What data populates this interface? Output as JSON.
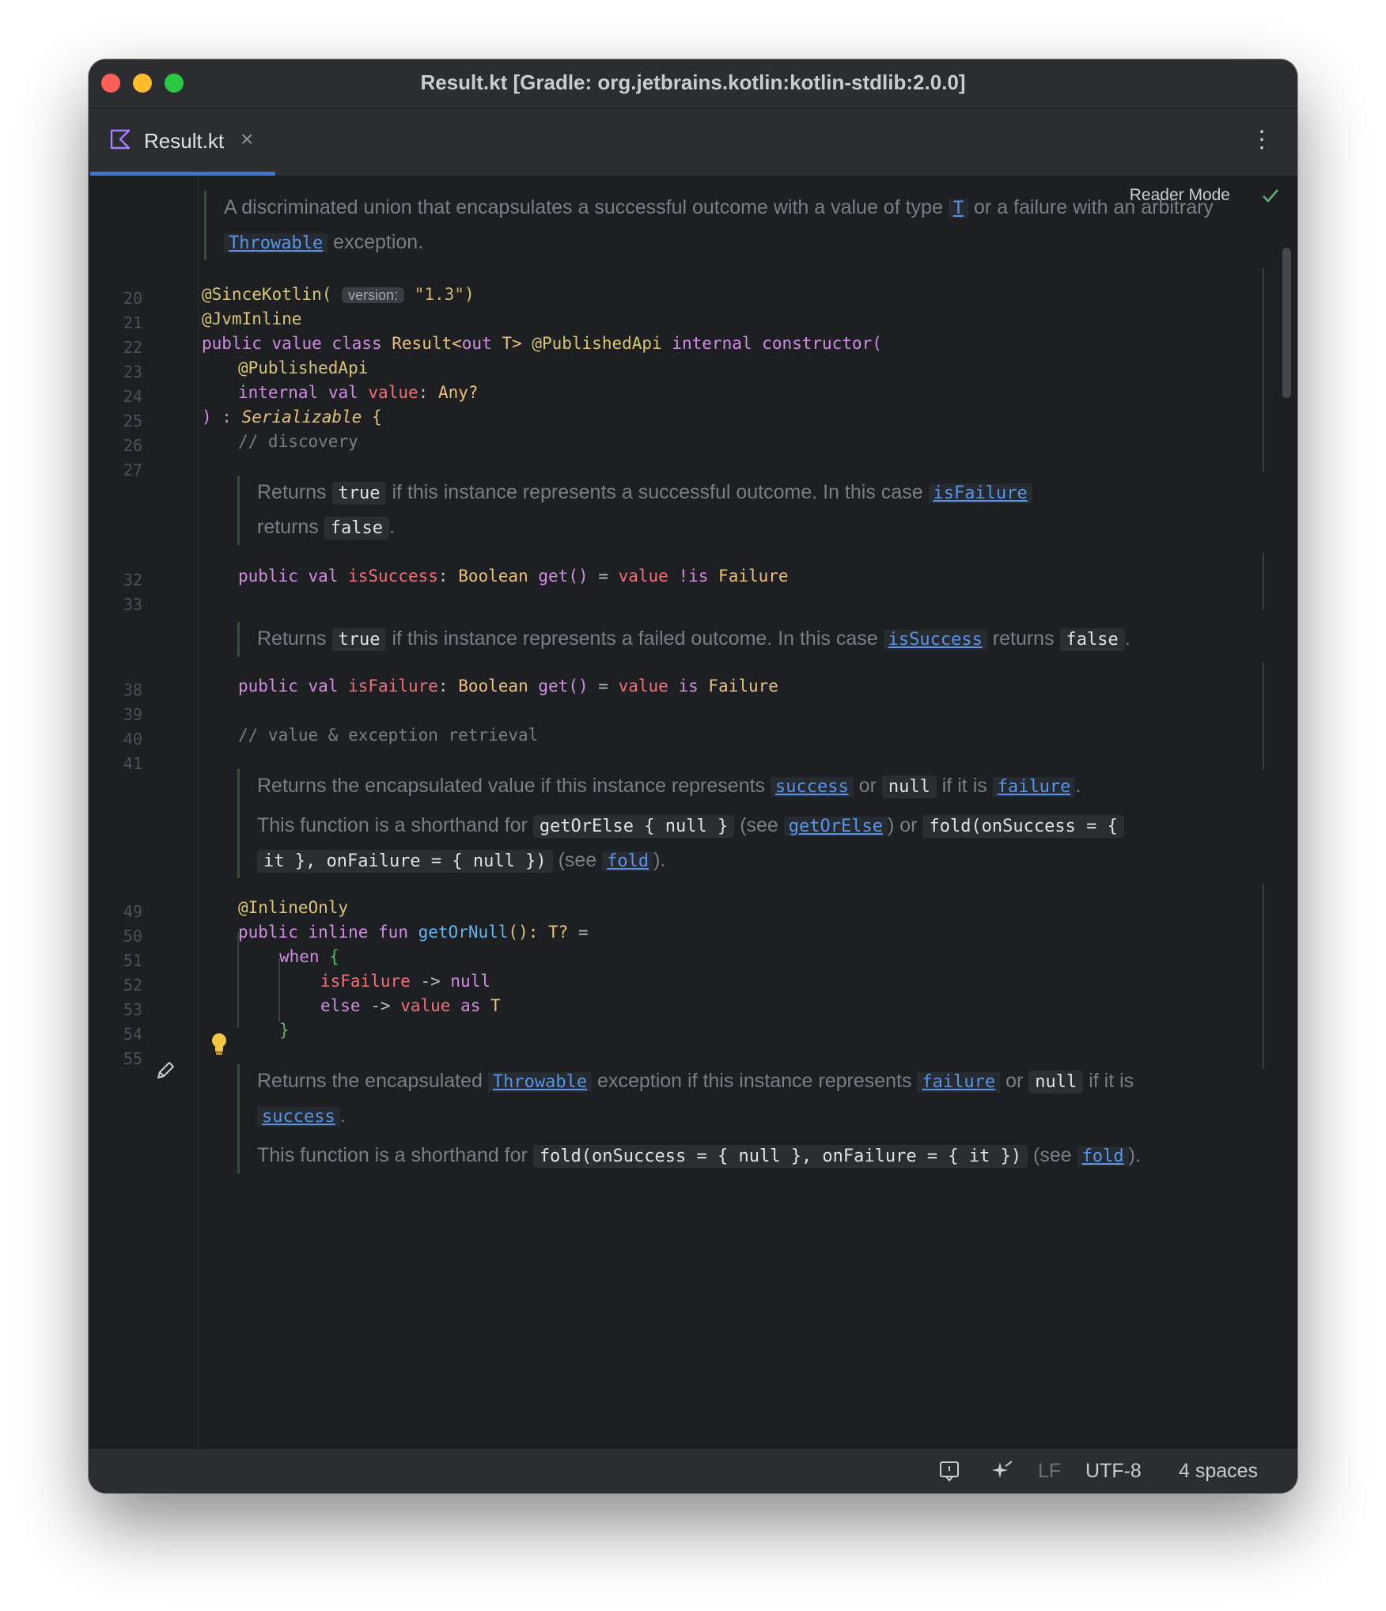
{
  "window": {
    "title": "Result.kt [Gradle: org.jetbrains.kotlin:kotlin-stdlib:2.0.0]"
  },
  "tab": {
    "label": "Result.kt",
    "close_glyph": "×",
    "more_glyph": "⋮",
    "icon": "kotlin-file-icon"
  },
  "editor": {
    "reader_mode_label": "Reader Mode",
    "line_numbers": [
      "20",
      "21",
      "22",
      "23",
      "24",
      "25",
      "26",
      "27",
      "32",
      "33",
      "38",
      "39",
      "40",
      "41",
      "49",
      "50",
      "51",
      "52",
      "53",
      "54",
      "55"
    ],
    "doc1": {
      "t1": "A discriminated union that encapsulates a successful outcome with a value of type",
      "link1": "T",
      "t2": "or a failure with an arbitrary",
      "link2": "Throwable",
      "t3": "exception."
    },
    "doc2": {
      "t1": "Returns",
      "code1": "true",
      "t2": "if this instance represents a successful outcome. In this case",
      "link1": "isFailure",
      "t3": "returns",
      "code2": "false",
      "t4": "."
    },
    "doc3": {
      "t1": "Returns",
      "code1": "true",
      "t2": "if this instance represents a failed outcome. In this case",
      "link1": "isSuccess",
      "t3": "returns",
      "code2": "false",
      "t4": "."
    },
    "doc4": {
      "p1_t1": "Returns the encapsulated value if this instance represents",
      "p1_link1": "success",
      "p1_t2": "or",
      "p1_code1": "null",
      "p1_t3": "if it is",
      "p1_link2": "failure",
      "p1_t4": ".",
      "p2_t1": "This function is a shorthand for",
      "p2_code1": "getOrElse { null }",
      "p2_t2": "(see",
      "p2_link1": "getOrElse",
      "p2_t3": ") or",
      "p2_code2a": "fold(onSuccess = {",
      "p2_code2b": "it }, onFailure = { null })",
      "p2_t4": "(see",
      "p2_link2": "fold",
      "p2_t5": ")."
    },
    "doc5": {
      "p1_t1": "Returns the encapsulated",
      "p1_link1": "Throwable",
      "p1_t2": "exception if this instance represents",
      "p1_link2": "failure",
      "p1_t3": "or",
      "p1_code1": "null",
      "p1_t4": "if it is",
      "p1_link3": "success",
      "p1_t5": ".",
      "p2_t1": "This function is a shorthand for",
      "p2_code1": "fold(onSuccess = { null }, onFailure = { it })",
      "p2_t2": "(see",
      "p2_link1": "fold",
      "p2_t3": ")."
    },
    "code": {
      "l20_ann": "@SinceKotlin(",
      "l20_hint": "version:",
      "l20_str": "\"1.3\"",
      "l20_close": ")",
      "l21": "@JvmInline",
      "l22_public": "public",
      "l22_value": "value",
      "l22_class": "class",
      "l22_name": "Result<",
      "l22_out": "out",
      "l22_t": "T>",
      "l22_pub_api": "@PublishedApi",
      "l22_internal": "internal",
      "l22_ctor": "constructor(",
      "l23": "@PublishedApi",
      "l24_internal": "internal",
      "l24_val": "val",
      "l24_value": "value",
      "l24_colon": ":",
      "l24_type": "Any?",
      "l25_paren": ") :",
      "l25_type": "Serializable",
      "l25_brace": "{",
      "l26": "// discovery",
      "l32_public": "public",
      "l32_val": "val",
      "l32_name": "isSuccess",
      "l32_colon": ":",
      "l32_type": "Boolean",
      "l32_get": "get()",
      "l32_eq": "=",
      "l32_value": "value",
      "l32_is": "!is",
      "l32_failure": "Failure",
      "l38_public": "public",
      "l38_val": "val",
      "l38_name": "isFailure",
      "l38_colon": ":",
      "l38_type": "Boolean",
      "l38_get": "get()",
      "l38_eq": "=",
      "l38_value": "value",
      "l38_is": "is",
      "l38_failure": "Failure",
      "l40": "// value & exception retrieval",
      "l49": "@InlineOnly",
      "l50_public": "public",
      "l50_inline": "inline",
      "l50_fun": "fun",
      "l50_name": "getOrNull",
      "l50_parens": "():",
      "l50_type": "T?",
      "l50_eq": "=",
      "l51_when": "when",
      "l51_brace": "{",
      "l52_name": "isFailure",
      "l52_arrow": "->",
      "l52_null": "null",
      "l53_else": "else",
      "l53_arrow": "->",
      "l53_value": "value",
      "l53_as": "as",
      "l53_t": "T",
      "l54": "}"
    }
  },
  "statusbar": {
    "line_sep": "LF",
    "encoding": "UTF-8",
    "indent": "4 spaces"
  },
  "colors": {
    "accent": "#3d74d8",
    "keyword": "#cf8ee0",
    "annotation": "#d9c677",
    "link": "#5a95e8",
    "comment": "#7a7e85"
  }
}
